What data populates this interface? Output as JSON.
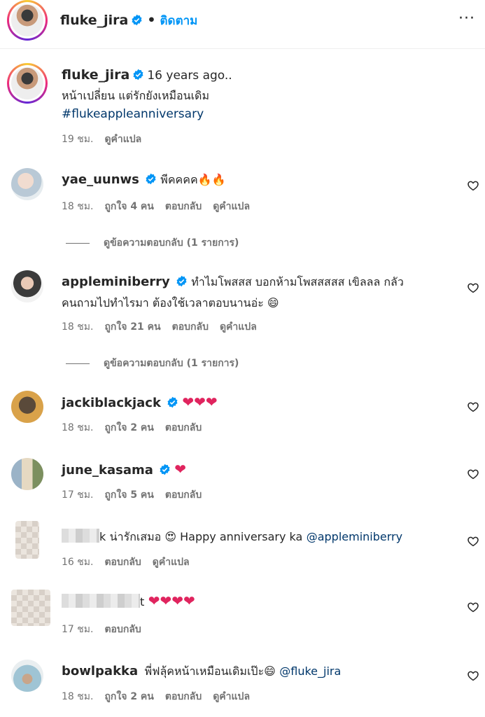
{
  "header": {
    "username": "fluke_jira",
    "follow_label": "ติดตาม",
    "more_label": "···"
  },
  "post": {
    "username": "fluke_jira",
    "ago": "16 years ago..",
    "caption": "หน้าเปลี่ยน แต่รักยังเหมือนเดิม",
    "hashtag": "#flukeappleanniversary",
    "time": "19 ชม.",
    "translate": "ดูคำแปล"
  },
  "comments": [
    {
      "username": "yae_uunws",
      "text": "พีคคคค🔥🔥",
      "time": "18 ชม.",
      "likes": "ถูกใจ 4 คน",
      "reply": "ตอบกลับ",
      "translate": "ดูคำแปล",
      "replies": "ดูข้อความตอบกลับ (1 รายการ)"
    },
    {
      "username": "appleminiberry",
      "text1": "ทำไมโพสสส บอกห้ามโพสสสสส เขิลลล กลัว",
      "text2": "คนถามไปทำไรมา ต้องใช้เวลาตอบนานอ่ะ 😄",
      "time": "18 ชม.",
      "likes": "ถูกใจ 21 คน",
      "reply": "ตอบกลับ",
      "translate": "ดูคำแปล",
      "replies": "ดูข้อความตอบกลับ (1 รายการ)"
    },
    {
      "username": "jackiblackjack",
      "text": "❤❤❤",
      "time": "18 ชม.",
      "likes": "ถูกใจ 2 คน",
      "reply": "ตอบกลับ"
    },
    {
      "username": "june_kasama",
      "text": "❤",
      "time": "17 ชม.",
      "likes": "ถูกใจ 5 คน",
      "reply": "ตอบกลับ"
    },
    {
      "username_tail": "k",
      "text": "น่ารักเสมอ 😍 Happy anniversary ka",
      "mention": "@appleminiberry",
      "time": "16 ชม.",
      "reply": "ตอบกลับ",
      "translate": "ดูคำแปล"
    },
    {
      "username_tail": "t",
      "text": "❤❤❤❤",
      "time": "17 ชม.",
      "reply": "ตอบกลับ"
    },
    {
      "username": "bowlpakka",
      "text": "พี่ฟลุ้คหน้าเหมือนเดิมเป๊ะ😄",
      "mention": "@fluke_jira",
      "time": "18 ชม.",
      "likes": "ถูกใจ 2 คน",
      "reply": "ตอบกลับ",
      "translate": "ดูคำแปล"
    }
  ],
  "colors": {
    "link": "#00376b",
    "follow": "#0095f6",
    "meta": "#737373",
    "heart": "#e0245e",
    "verified": "#0095f6"
  }
}
